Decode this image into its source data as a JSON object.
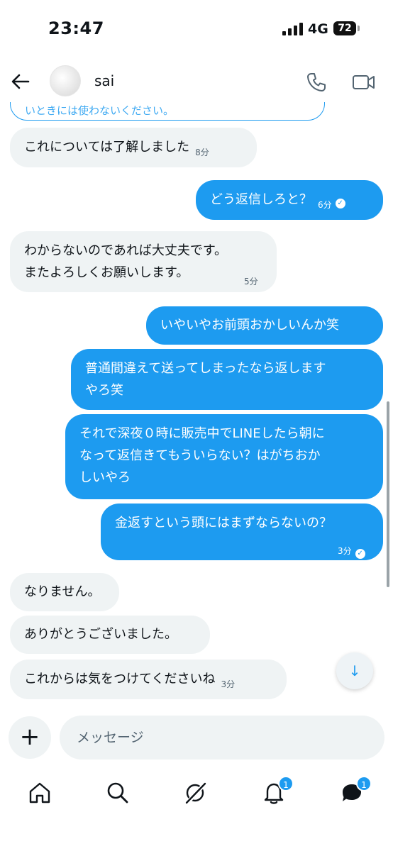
{
  "status_bar": {
    "time": "23:47",
    "network": "4G",
    "battery": "72"
  },
  "header": {
    "contact_name": "sai",
    "icons": [
      "back-arrow-icon",
      "avatar",
      "phone-icon",
      "video-camera-icon"
    ]
  },
  "messages": {
    "partial_top_text": "いときには使わないください。",
    "items": [
      {
        "direction": "in",
        "text": "これについては了解しました",
        "time": "8分"
      },
      {
        "direction": "out",
        "text": "どう返信しろと？",
        "time": "6分"
      },
      {
        "direction": "in",
        "lines": [
          "わからないのであれば大丈夫です。",
          "またよろしくお願いします。"
        ],
        "time": "5分"
      },
      {
        "direction": "out",
        "text": "いやいやお前頭おかしいんか笑"
      },
      {
        "direction": "out",
        "lines": [
          "普通間違えて送ってしまったなら返します",
          "やろ笑"
        ]
      },
      {
        "direction": "out",
        "lines": [
          "それで深夜０時に販売中でLINEしたら朝に",
          "なって返信きてもういらない？はがちおか",
          "しいやろ"
        ]
      },
      {
        "direction": "out",
        "text": "金返すという頭にはまずならないの？",
        "time": "3分"
      },
      {
        "direction": "in",
        "text": "なりません。"
      },
      {
        "direction": "in",
        "text": "ありがとうございました。"
      },
      {
        "direction": "in",
        "text": "これからは気をつけてくださいね",
        "time": "3分"
      }
    ]
  },
  "composer": {
    "placeholder": "メッセージ"
  },
  "bottom_nav": {
    "items": [
      "home-icon",
      "search-icon",
      "grok-icon",
      "notifications-icon",
      "messages-icon"
    ],
    "notifications_badge": "1",
    "messages_badge": "1"
  },
  "colors": {
    "accent": "#1d9bf0",
    "incoming_bubble": "#eff3f4",
    "text": "#0f1419",
    "secondary_text": "#536471"
  }
}
